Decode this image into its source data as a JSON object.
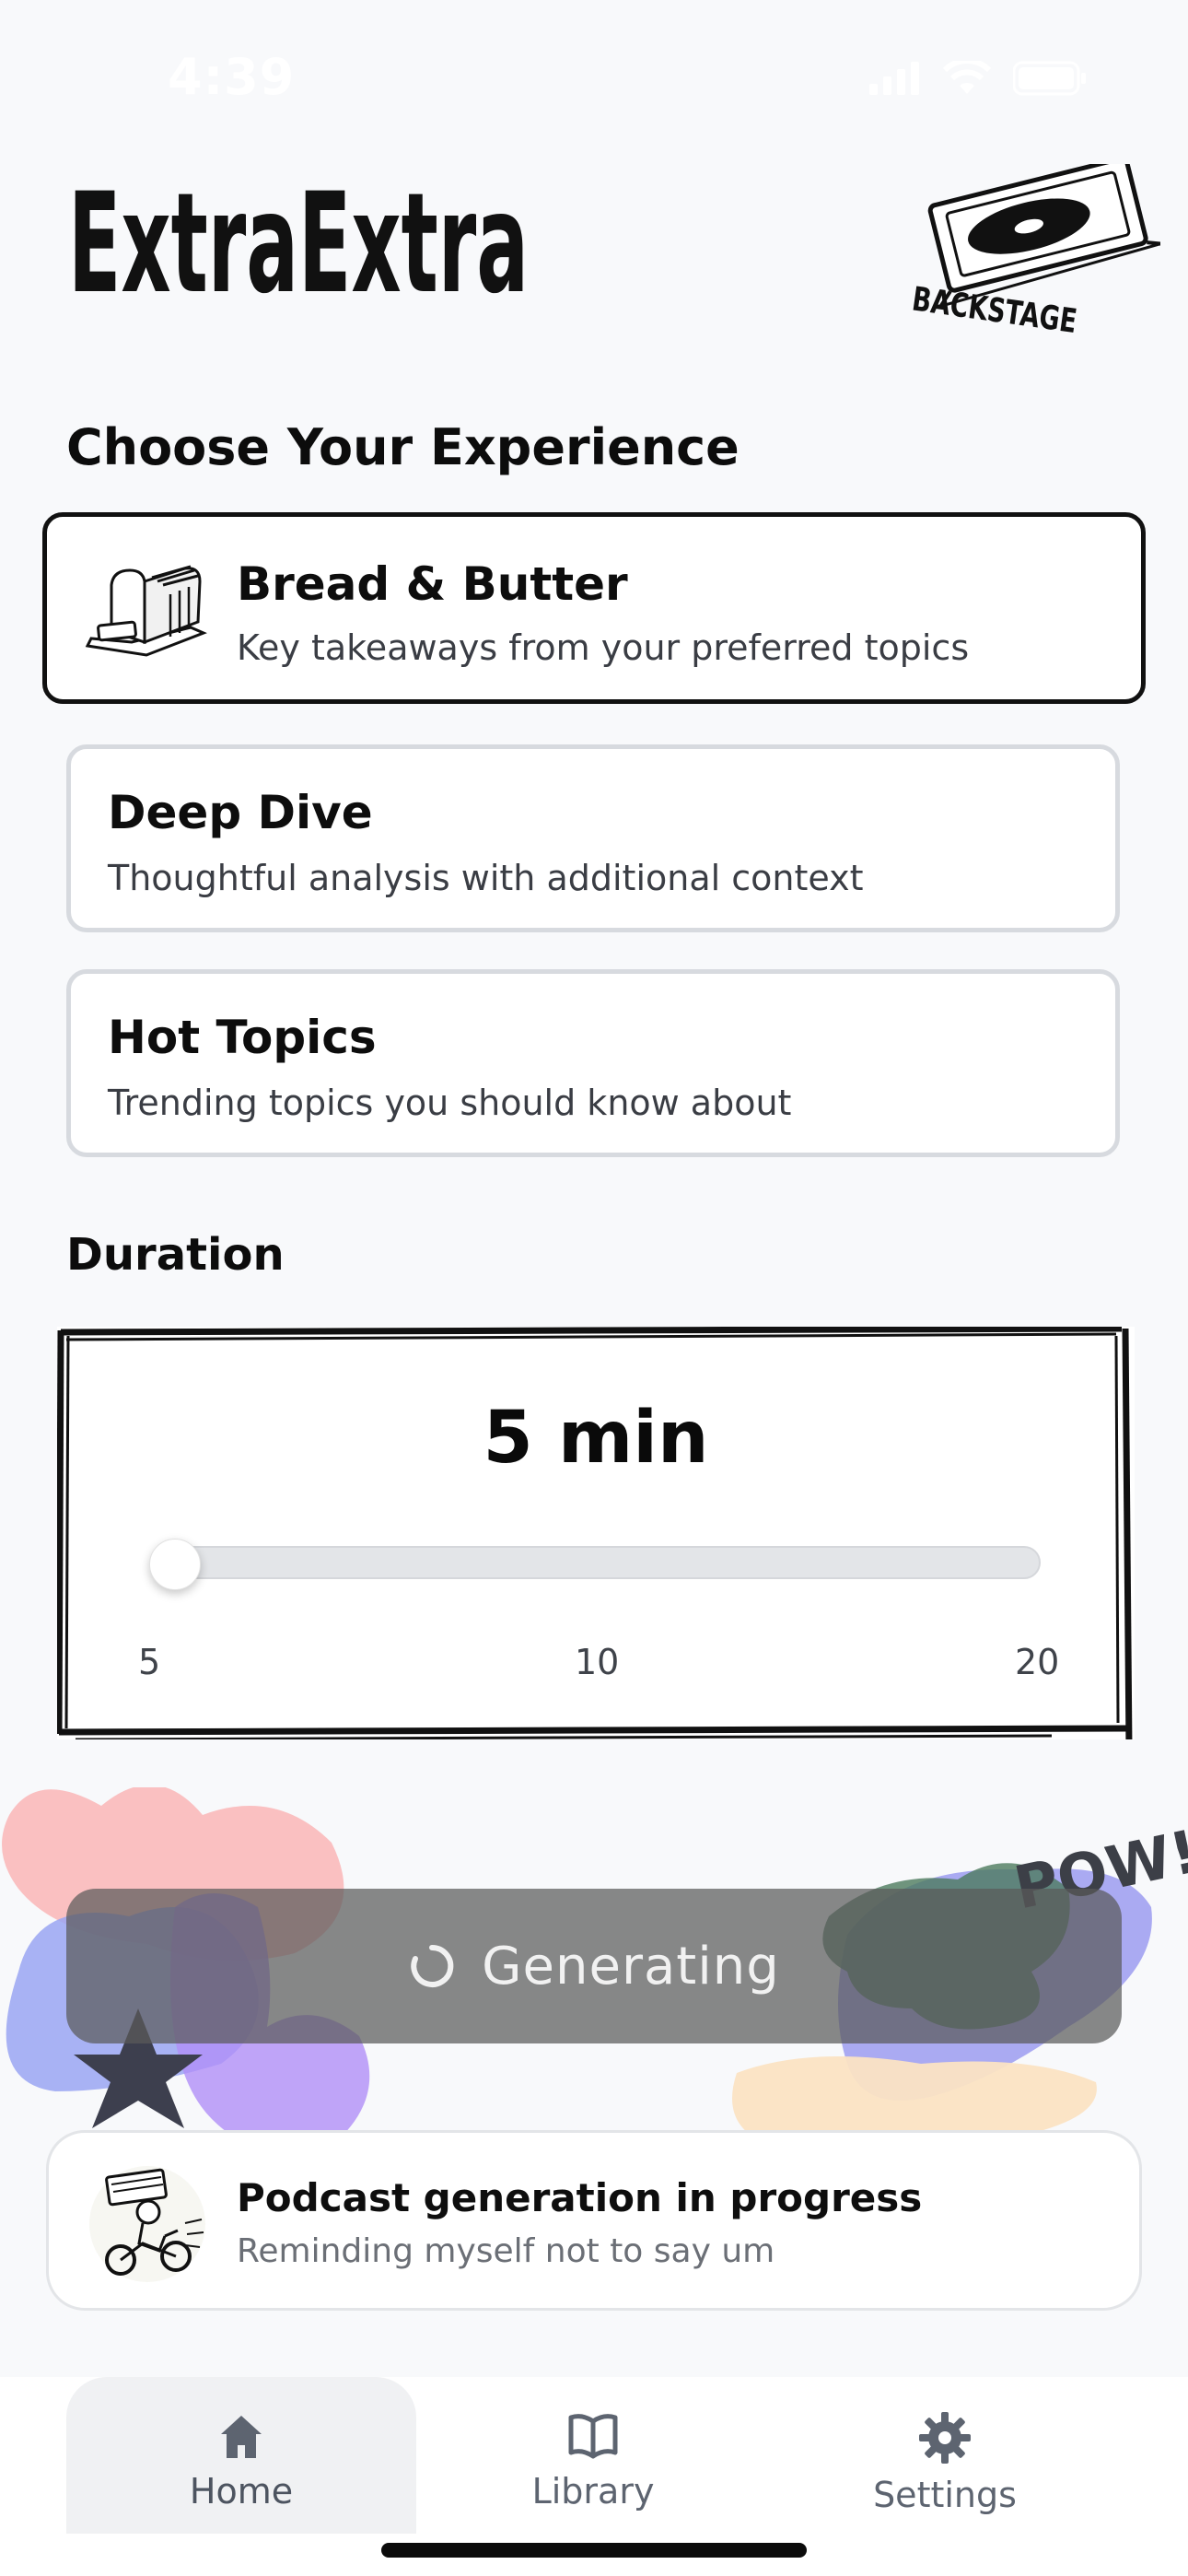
{
  "status_bar": {
    "time": "4:39"
  },
  "header": {
    "logo_text": "ExtraExtra",
    "partner_logo_text": "BACKSTAGE"
  },
  "experience": {
    "title": "Choose Your Experience",
    "options": [
      {
        "title": "Bread & Butter",
        "subtitle": "Key takeaways from your preferred topics",
        "selected": true,
        "icon": "bread-icon"
      },
      {
        "title": "Deep Dive",
        "subtitle": "Thoughtful analysis with additional context",
        "selected": false
      },
      {
        "title": "Hot Topics",
        "subtitle": "Trending topics you should know about",
        "selected": false
      }
    ]
  },
  "duration": {
    "title": "Duration",
    "value_label": "5 min",
    "ticks": [
      "5",
      "10",
      "20"
    ],
    "slider_position": 0
  },
  "decor": {
    "pow_text": "POW!"
  },
  "generate": {
    "label": "Generating",
    "icon": "spinner-icon"
  },
  "progress": {
    "title": "Podcast generation in progress",
    "subtitle": "Reminding myself not to say um",
    "icon": "newsboy-bike-icon"
  },
  "tabs": [
    {
      "label": "Home",
      "icon": "home-icon",
      "active": true
    },
    {
      "label": "Library",
      "icon": "book-icon",
      "active": false
    },
    {
      "label": "Settings",
      "icon": "gear-icon",
      "active": false
    }
  ],
  "colors": {
    "background": "#f8f9fb",
    "selected_border": "#111111",
    "unselected_border": "#d7dadf",
    "generate_button": "#5a5a5a",
    "tab_active_bg": "#f0f1f3"
  }
}
